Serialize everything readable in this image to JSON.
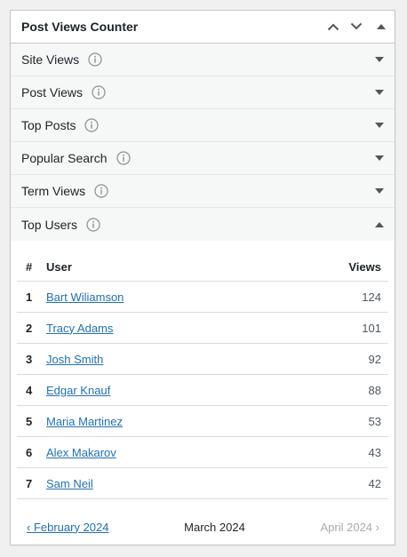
{
  "widget": {
    "title": "Post Views Counter",
    "sections": [
      {
        "label": "Site Views",
        "expanded": false
      },
      {
        "label": "Post Views",
        "expanded": false
      },
      {
        "label": "Top Posts",
        "expanded": false
      },
      {
        "label": "Popular Search",
        "expanded": false
      },
      {
        "label": "Term Views",
        "expanded": false
      },
      {
        "label": "Top Users",
        "expanded": true
      }
    ],
    "icons": {
      "move_up": "chevron-up-icon",
      "move_down": "chevron-down-icon",
      "toggle": "triangle-up-icon",
      "info": "info-icon"
    }
  },
  "table": {
    "headers": {
      "num": "#",
      "user": "User",
      "views": "Views"
    },
    "rows": [
      {
        "num": "1",
        "user": "Bart Wiliamson",
        "views": "124"
      },
      {
        "num": "2",
        "user": "Tracy Adams",
        "views": "101"
      },
      {
        "num": "3",
        "user": "Josh Smith",
        "views": "92"
      },
      {
        "num": "4",
        "user": "Edgar Knauf",
        "views": "88"
      },
      {
        "num": "5",
        "user": "Maria Martinez",
        "views": "53"
      },
      {
        "num": "6",
        "user": "Alex Makarov",
        "views": "43"
      },
      {
        "num": "7",
        "user": "Sam Neil",
        "views": "42"
      }
    ]
  },
  "pager": {
    "prev": "‹ February 2024",
    "current": "March 2024",
    "next": "April 2024 ›"
  },
  "colors": {
    "link": "#2271b1",
    "disabled": "#a7aaad",
    "border": "#c3c4c7",
    "section_bg": "#f6f7f7"
  }
}
